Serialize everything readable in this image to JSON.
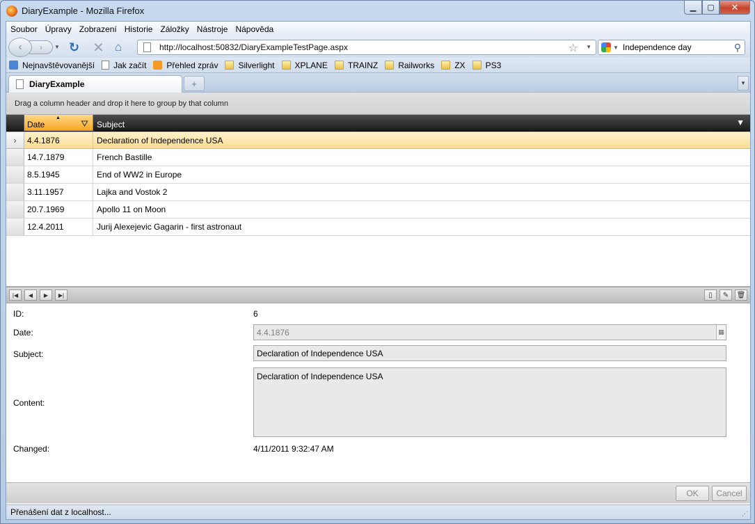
{
  "window": {
    "title": "DiaryExample - Mozilla Firefox"
  },
  "menu": [
    "Soubor",
    "Úpravy",
    "Zobrazení",
    "Historie",
    "Záložky",
    "Nástroje",
    "Nápověda"
  ],
  "address": {
    "url": "http://localhost:50832/DiaryExampleTestPage.aspx"
  },
  "search": {
    "query": "Independence day"
  },
  "bookmarks": [
    {
      "label": "Nejnavštěvovanější",
      "icon": "most-visited-icon"
    },
    {
      "label": "Jak začít",
      "icon": "page-icon"
    },
    {
      "label": "Přehled zpráv",
      "icon": "rss-icon"
    },
    {
      "label": "Silverlight",
      "icon": "folder-icon"
    },
    {
      "label": "XPLANE",
      "icon": "folder-icon"
    },
    {
      "label": "TRAINZ",
      "icon": "folder-icon"
    },
    {
      "label": "Railworks",
      "icon": "folder-icon"
    },
    {
      "label": "ZX",
      "icon": "folder-icon"
    },
    {
      "label": "PS3",
      "icon": "folder-icon"
    }
  ],
  "tab": {
    "label": "DiaryExample",
    "new_tab_glyph": "+"
  },
  "grid": {
    "group_hint": "Drag a column header and drop it here to group by that column",
    "columns": {
      "date": "Date",
      "subject": "Subject"
    },
    "rows": [
      {
        "date": "4.4.1876",
        "subject": "Declaration of Independence USA",
        "selected": true
      },
      {
        "date": "14.7.1879",
        "subject": "French Bastille"
      },
      {
        "date": "8.5.1945",
        "subject": "End of WW2 in Europe"
      },
      {
        "date": "3.11.1957",
        "subject": "Lajka and Vostok 2"
      },
      {
        "date": "20.7.1969",
        "subject": "Apollo 11 on Moon"
      },
      {
        "date": "12.4.2011",
        "subject": "Jurij Alexejevic Gagarin - first astronaut"
      }
    ]
  },
  "form": {
    "labels": {
      "id": "ID:",
      "date": "Date:",
      "subject": "Subject:",
      "content": "Content:",
      "changed": "Changed:"
    },
    "values": {
      "id": "6",
      "date": "4.4.1876",
      "subject": "Declaration of Independence USA",
      "content": "Declaration of Independence USA",
      "changed": "4/11/2011 9:32:47 AM"
    }
  },
  "buttons": {
    "ok": "OK",
    "cancel": "Cancel"
  },
  "status": {
    "text": "Přenášení dat z localhost..."
  }
}
